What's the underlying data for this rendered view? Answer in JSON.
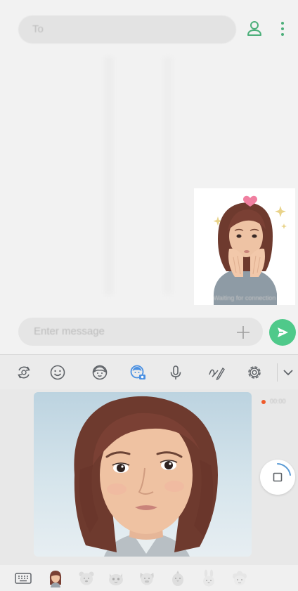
{
  "header": {
    "to_placeholder": "To",
    "contact_icon": "person-icon",
    "more_icon": "more-vertical-icon"
  },
  "conversation": {
    "sticker_status": "Waiting for connection"
  },
  "composer": {
    "placeholder": "Enter message",
    "add_icon": "plus-icon",
    "send_icon": "send-icon"
  },
  "toolbar": {
    "items": [
      {
        "name": "rotate-icon"
      },
      {
        "name": "emoji-icon"
      },
      {
        "name": "ar-emoji-icon"
      },
      {
        "name": "ar-camera-icon",
        "active": true
      },
      {
        "name": "microphone-icon"
      },
      {
        "name": "handwriting-icon"
      },
      {
        "name": "settings-icon"
      },
      {
        "name": "chevron-down-icon"
      }
    ]
  },
  "camera": {
    "rec_label": "00:00",
    "stop_icon": "stop-icon"
  },
  "colors": {
    "accent_green": "#4fc98a",
    "active_blue": "#4a90e2",
    "record_red": "#ef5a2a",
    "hair": "#7a4034"
  }
}
